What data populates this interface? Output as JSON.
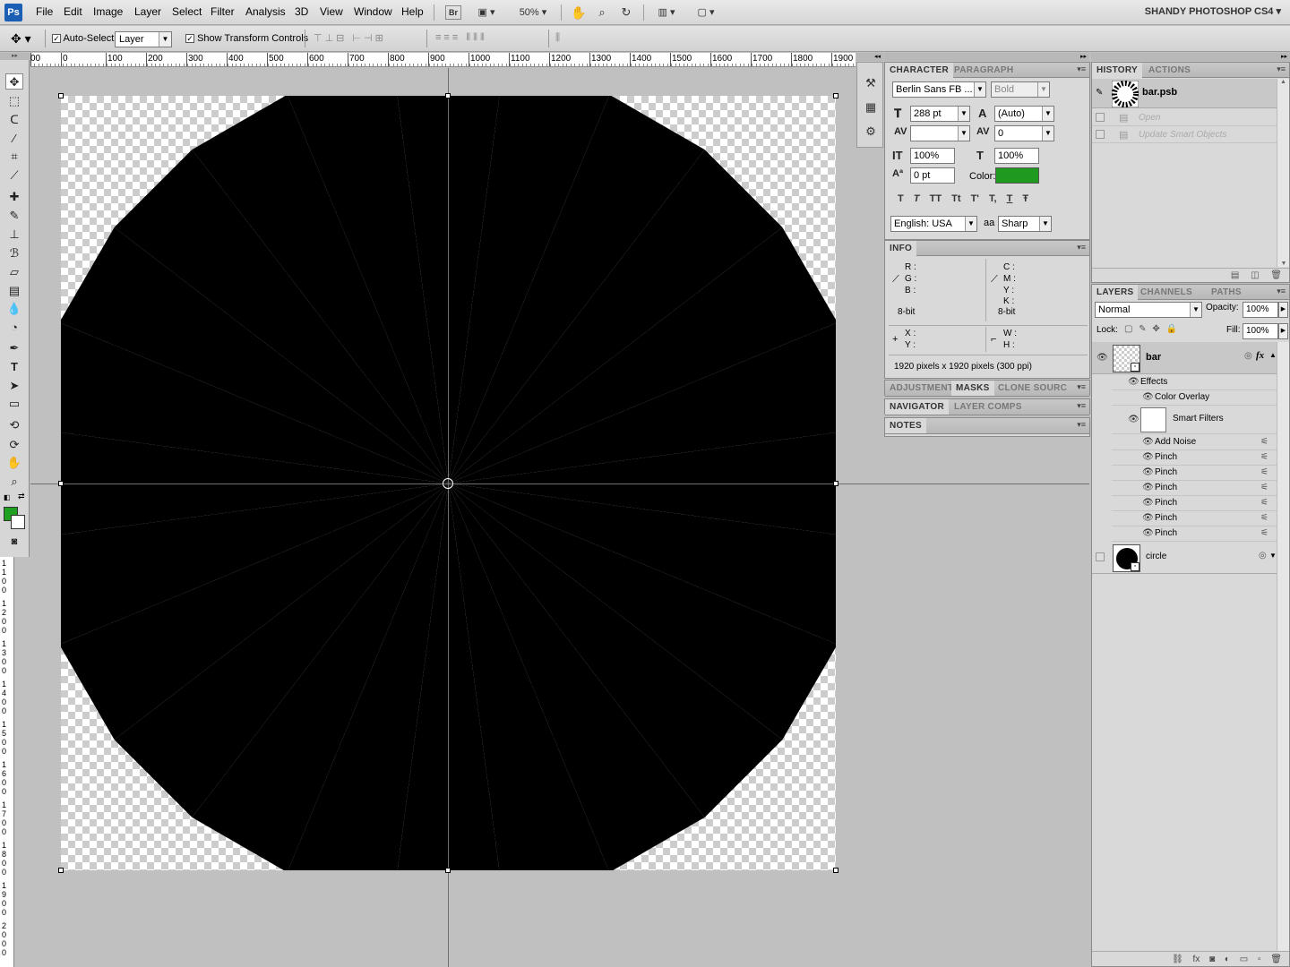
{
  "app": {
    "logo": "Ps",
    "workspace": "SHANDY PHOTOSHOP CS4"
  },
  "menu": [
    "File",
    "Edit",
    "Image",
    "Layer",
    "Select",
    "Filter",
    "Analysis",
    "3D",
    "View",
    "Window",
    "Help"
  ],
  "menubar_tools": {
    "bridge": "Br",
    "zoom": "50%"
  },
  "options": {
    "auto_select_label": "Auto-Select:",
    "auto_select_value": "Layer",
    "show_transform_label": "Show Transform Controls"
  },
  "ruler": {
    "labels": [
      "00",
      "0",
      "100",
      "200",
      "300",
      "400",
      "500",
      "600",
      "700",
      "800",
      "900",
      "1000",
      "1100",
      "1200",
      "1300",
      "1400",
      "1500",
      "1600",
      "1700",
      "1800",
      "1900"
    ],
    "vlabels": [
      "1100",
      "1200",
      "1300",
      "1400",
      "1500",
      "1600",
      "1700",
      "1800",
      "1900",
      "2000"
    ]
  },
  "character": {
    "tabs": [
      "CHARACTER",
      "PARAGRAPH"
    ],
    "font_family": "Berlin Sans FB ...",
    "font_style": "Bold",
    "size": "288 pt",
    "leading": "(Auto)",
    "kerning": "",
    "tracking": "0",
    "vscale": "100%",
    "hscale": "100%",
    "baseline": "0 pt",
    "color_label": "Color:",
    "color": "#1f9a1f",
    "style_buttons": [
      "T",
      "T",
      "TT",
      "Tt",
      "T'",
      "T,",
      "T",
      "Ŧ"
    ],
    "language": "English: USA",
    "aa_icon": "aa",
    "antialias": "Sharp"
  },
  "info": {
    "tab": "INFO",
    "rgb": [
      "R :",
      "G :",
      "B :"
    ],
    "cmyk": [
      "C :",
      "M :",
      "Y :",
      "K :"
    ],
    "bit_left": "8-bit",
    "bit_right": "8-bit",
    "xy": [
      "X :",
      "Y :"
    ],
    "wh": [
      "W :",
      "H :"
    ],
    "doc": "1920 pixels x 1920 pixels (300 ppi)"
  },
  "collapsed_tabs": {
    "row1": [
      "ADJUSTMENT",
      "MASKS",
      "CLONE SOURC"
    ],
    "row2": [
      "NAVIGATOR",
      "LAYER COMPS"
    ],
    "row3": [
      "NOTES"
    ]
  },
  "history": {
    "tabs": [
      "HISTORY",
      "ACTIONS"
    ],
    "snapshot": "bar.psb",
    "items": [
      "Open",
      "Update Smart Objects"
    ]
  },
  "layers": {
    "tabs": [
      "LAYERS",
      "CHANNELS",
      "PATHS"
    ],
    "blend_mode": "Normal",
    "opacity_label": "Opacity:",
    "opacity": "100%",
    "lock_label": "Lock:",
    "fill_label": "Fill:",
    "fill": "100%",
    "bar_layer": "bar",
    "effects_label": "Effects",
    "color_overlay": "Color Overlay",
    "smart_filters": "Smart Filters",
    "filters": [
      "Add Noise",
      "Pinch",
      "Pinch",
      "Pinch",
      "Pinch",
      "Pinch",
      "Pinch"
    ],
    "circle_layer": "circle"
  },
  "icons": [
    "move-tool-icon",
    "marquee-icon",
    "lasso-icon",
    "magic-wand-icon",
    "crop-icon",
    "eyedropper-icon",
    "healing-brush-icon",
    "brush-icon",
    "clone-stamp-icon",
    "history-brush-icon",
    "eraser-icon",
    "gradient-icon",
    "blur-icon",
    "dodge-icon",
    "pen-icon",
    "type-icon",
    "path-selection-icon",
    "shape-icon",
    "3d-rotate-icon",
    "3d-orbit-icon",
    "hand-icon",
    "zoom-icon"
  ]
}
